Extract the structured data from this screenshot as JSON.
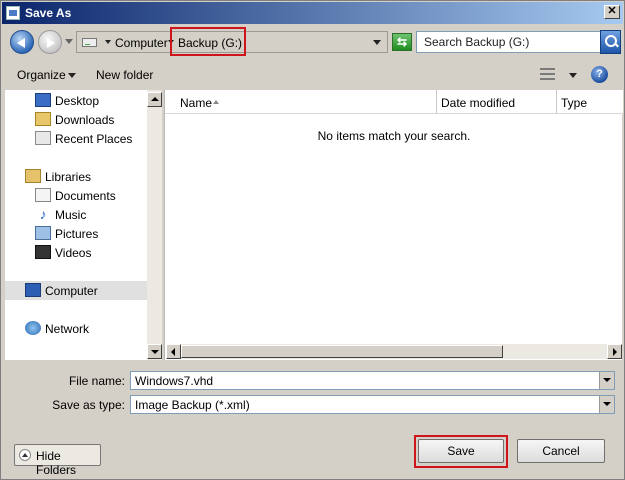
{
  "window": {
    "title": "Save As",
    "close_label": "✕"
  },
  "address": {
    "crumbs": [
      "Computer",
      "Backup (G:)"
    ],
    "search_placeholder": "Search Backup (G:)"
  },
  "toolbar": {
    "organize_label": "Organize",
    "new_folder_label": "New folder",
    "help_label": "?"
  },
  "nav": {
    "items": [
      {
        "label": "Desktop",
        "icon": "desktop-icon"
      },
      {
        "label": "Downloads",
        "icon": "downloads-icon"
      },
      {
        "label": "Recent Places",
        "icon": "recent-places-icon"
      },
      {
        "label": "Libraries",
        "icon": "libraries-icon"
      },
      {
        "label": "Documents",
        "icon": "documents-icon"
      },
      {
        "label": "Music",
        "icon": "music-icon"
      },
      {
        "label": "Pictures",
        "icon": "pictures-icon"
      },
      {
        "label": "Videos",
        "icon": "videos-icon"
      },
      {
        "label": "Computer",
        "icon": "computer-icon",
        "selected": true
      },
      {
        "label": "Network",
        "icon": "network-icon"
      }
    ]
  },
  "filelist": {
    "columns": [
      "Name",
      "Date modified",
      "Type"
    ],
    "empty_message": "No items match your search."
  },
  "form": {
    "filename_label": "File name:",
    "filename_value": "Windows7.vhd",
    "type_label": "Save as type:",
    "type_value": "Image Backup (*.xml)"
  },
  "buttons": {
    "hide_folders": "Hide Folders",
    "save": "Save",
    "cancel": "Cancel"
  },
  "colors": {
    "highlight": "#d0141b",
    "accent": "#0a246a"
  }
}
